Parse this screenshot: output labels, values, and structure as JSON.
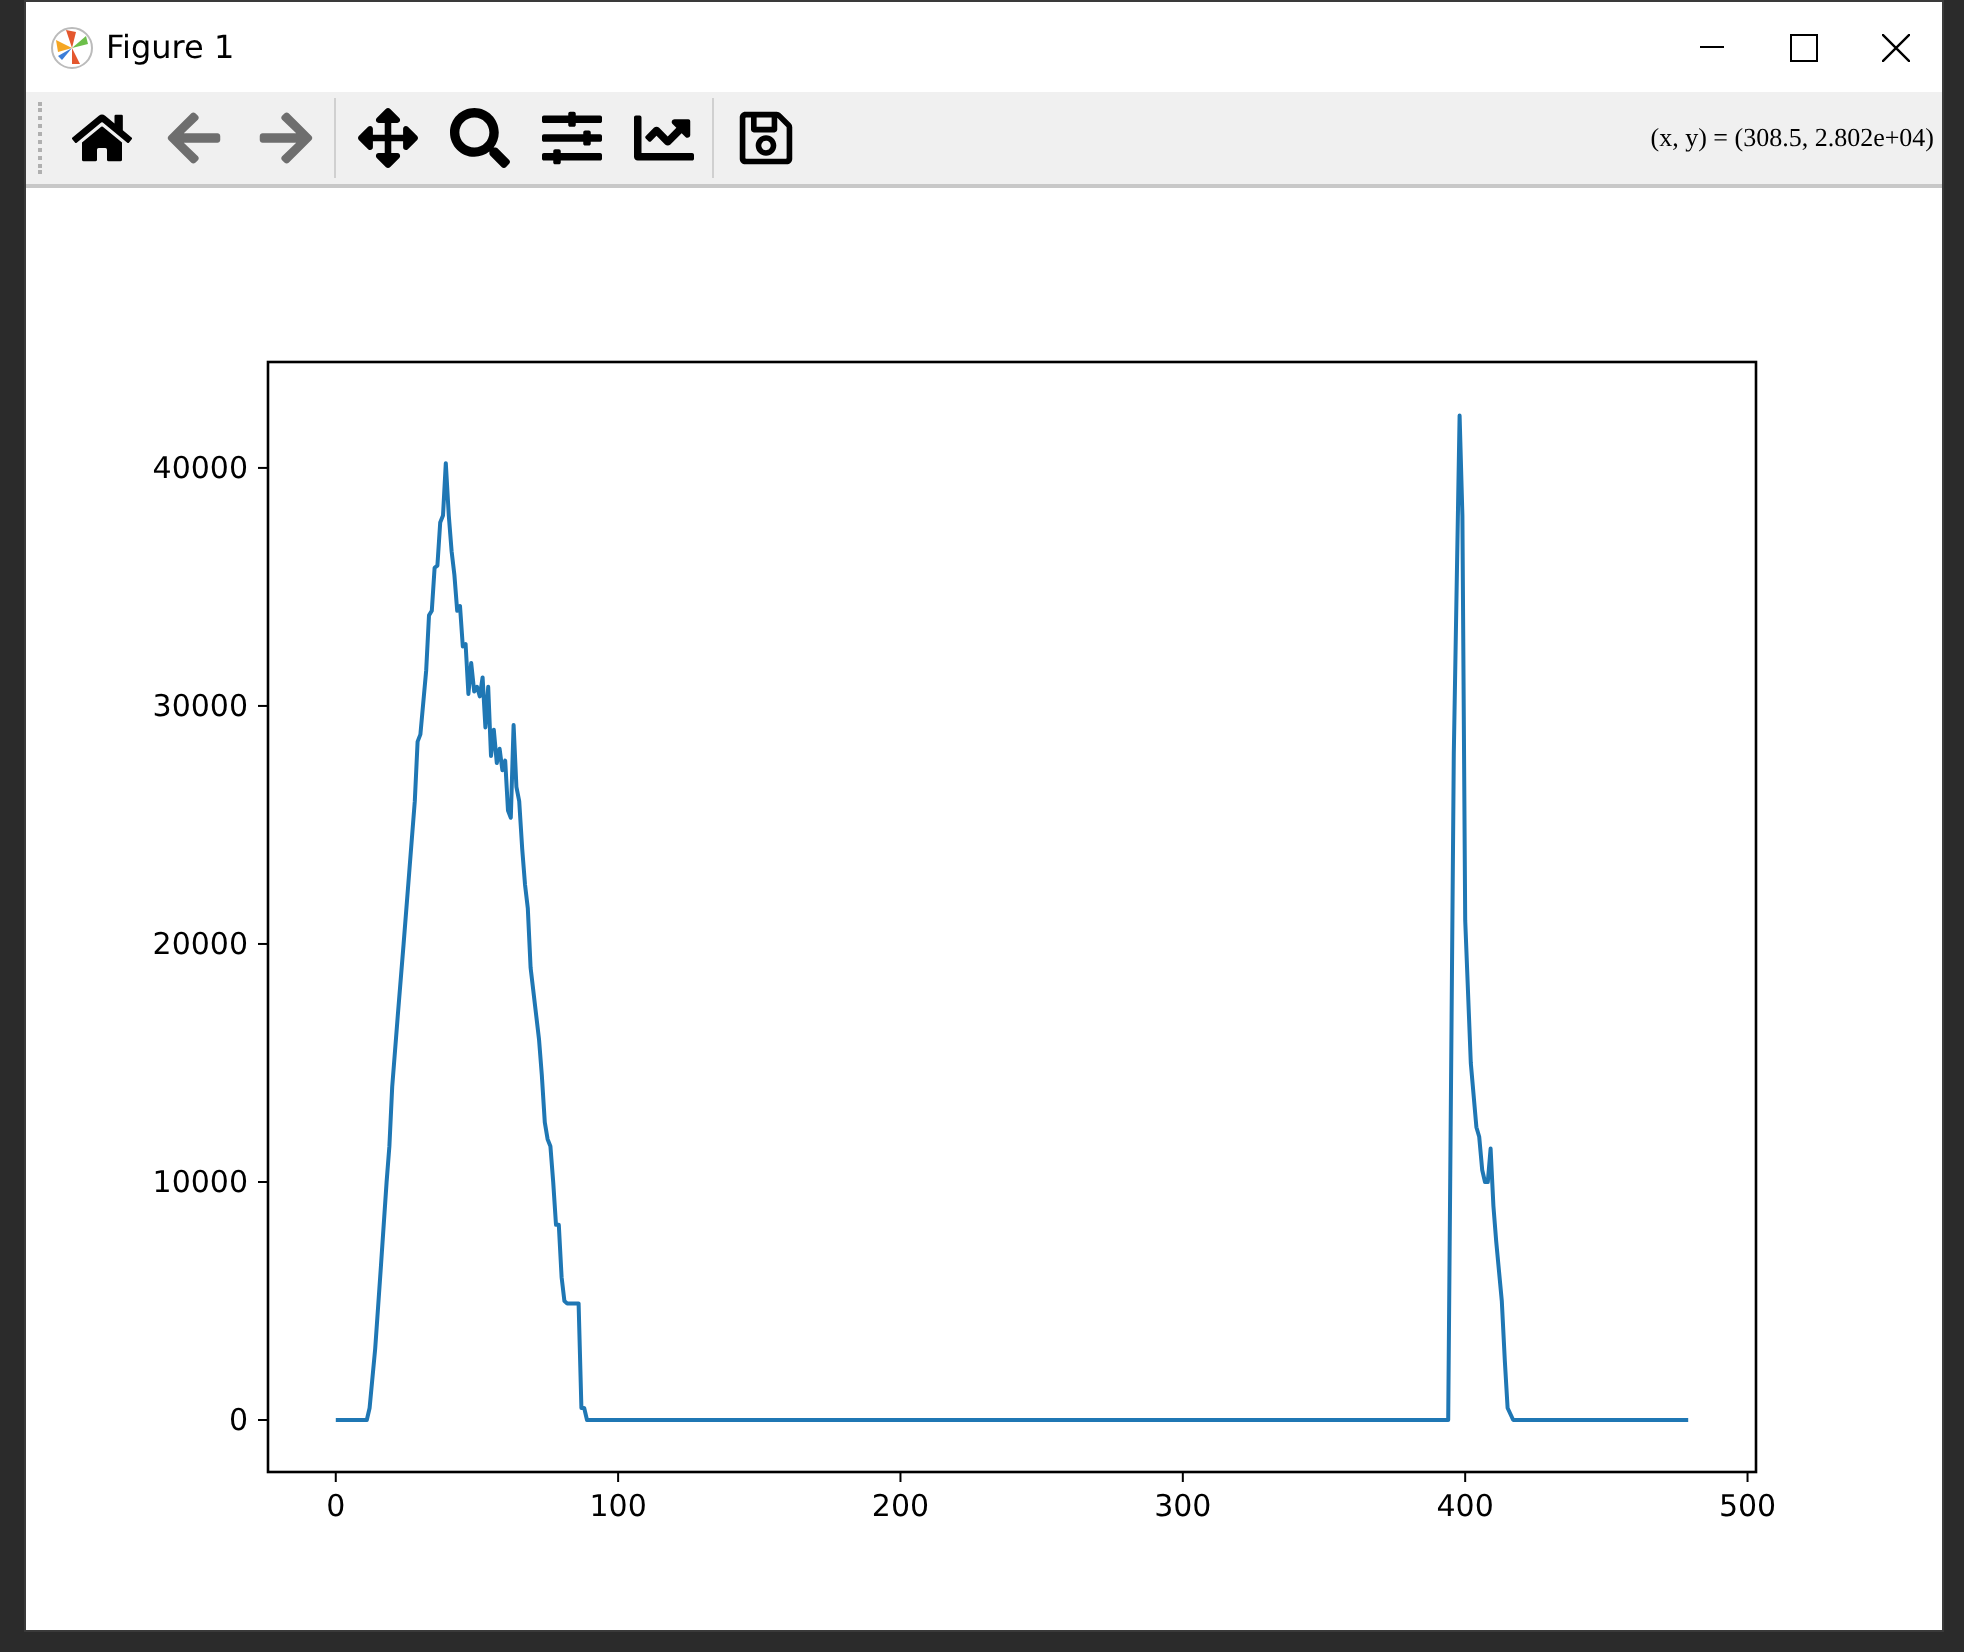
{
  "window": {
    "title": "Figure 1"
  },
  "toolbar": {
    "groups": [
      [
        {
          "kind": "home",
          "disabled": false
        },
        {
          "kind": "back",
          "disabled": true
        },
        {
          "kind": "forward",
          "disabled": true
        }
      ],
      [
        {
          "kind": "pan",
          "disabled": false
        },
        {
          "kind": "zoom",
          "disabled": false
        },
        {
          "kind": "configure",
          "disabled": false
        },
        {
          "kind": "edit",
          "disabled": false
        }
      ],
      [
        {
          "kind": "save",
          "disabled": false
        }
      ]
    ],
    "coordinates": "(x, y) = (308.5, 2.802e+04)"
  },
  "figure": {
    "chart_data": {
      "type": "line",
      "xlim": [
        -24,
        503
      ],
      "ylim": [
        -2185,
        44450
      ],
      "xticks": [
        0,
        100,
        200,
        300,
        400,
        500
      ],
      "yticks": [
        0,
        10000,
        20000,
        30000,
        40000
      ],
      "x": [
        0,
        11,
        12,
        14,
        16,
        18,
        19,
        20,
        22,
        24,
        26,
        28,
        29,
        30,
        32,
        33,
        34,
        35,
        36,
        37,
        38,
        39,
        40,
        41,
        42,
        43,
        44,
        45,
        46,
        47,
        48,
        49,
        50,
        51,
        52,
        53,
        54,
        55,
        56,
        57,
        58,
        59,
        60,
        61,
        62,
        63,
        64,
        65,
        66,
        67,
        68,
        69,
        70,
        72,
        73,
        74,
        75,
        76,
        77,
        78,
        79,
        80,
        81,
        82,
        86,
        87,
        88,
        89,
        394,
        396,
        398,
        399,
        400,
        402,
        404,
        405,
        406,
        407,
        408,
        409,
        410,
        411,
        413,
        414,
        415,
        417,
        479
      ],
      "series": [
        {
          "color": "#1f77b4",
          "values": [
            0,
            0,
            500,
            3000,
            6500,
            10000,
            11500,
            14000,
            17000,
            20000,
            23000,
            26000,
            28500,
            28800,
            31500,
            33800,
            34000,
            35800,
            35900,
            37700,
            38000,
            40200,
            38000,
            36500,
            35500,
            34000,
            34200,
            32500,
            32600,
            30500,
            31800,
            30600,
            30800,
            30400,
            31200,
            29100,
            30800,
            27900,
            29000,
            27600,
            28200,
            27300,
            27700,
            25600,
            25300,
            29200,
            26600,
            26000,
            24000,
            22500,
            21500,
            19000,
            18000,
            16000,
            14500,
            12500,
            11800,
            11500,
            10000,
            8200,
            8200,
            6000,
            5000,
            4900,
            4900,
            500,
            500,
            0,
            0,
            28000,
            42200,
            38000,
            21000,
            15000,
            12300,
            11900,
            10500,
            10000,
            10000,
            11400,
            9000,
            7500,
            5000,
            2500,
            500,
            0,
            0
          ]
        }
      ]
    }
  }
}
